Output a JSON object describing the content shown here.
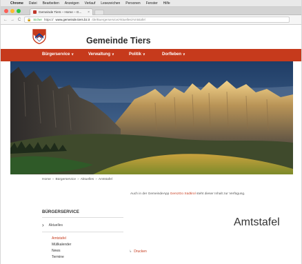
{
  "menubar": {
    "apple": "",
    "app": "Chrome",
    "items": [
      "Datei",
      "Bearbeiten",
      "Anzeigen",
      "Verlauf",
      "Lesezeichen",
      "Personen",
      "Fenster",
      "Hilfe"
    ]
  },
  "browser": {
    "tab_title": "Gemeinde Tiers – Home – G...",
    "tab_close": "×",
    "nav_back": "←",
    "nav_forward": "→",
    "nav_reload": "C",
    "lock_icon": "🔒",
    "secure_label": "Sicher",
    "url_scheme": "https://",
    "url_host": "www.gemeinde.tiers.bz.it",
    "url_path": "/de/Buergerservice/Aktuelles/Amtstafel"
  },
  "site": {
    "title": "Gemeinde Tiers",
    "nav": [
      {
        "label": "Bürgerservice",
        "chev": "∨"
      },
      {
        "label": "Verwaltung",
        "chev": "∨"
      },
      {
        "label": "Politik",
        "chev": "∨"
      },
      {
        "label": "Dorfleben",
        "chev": "∨"
      }
    ]
  },
  "breadcrumb": {
    "home": "Home",
    "level1": "Bürgerservice",
    "level2": "Aktuelles",
    "current": "Amtstafel",
    "sep": "»"
  },
  "notice": {
    "before": "Auch in der GemeindeApp ",
    "link": "Gem2Go Südtirol",
    "after": " steht dieser Inhalt zur Verfügung."
  },
  "sidebar": {
    "title": "BÜRGERSERVICE",
    "parent": "Aktuelles",
    "parent_arrow": "›",
    "items": [
      "Amtstafel",
      "Müllkalender",
      "News",
      "Termine"
    ]
  },
  "content": {
    "heading": "Amtstafel",
    "print_icon": "↳",
    "print": "Drucken"
  },
  "colors": {
    "brand": "#c63a1c",
    "secure": "#2e9e3c"
  }
}
